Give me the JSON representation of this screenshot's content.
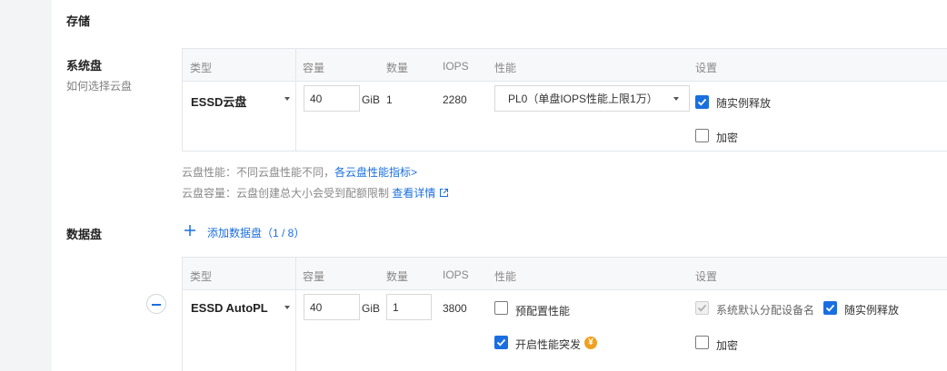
{
  "storage": {
    "title": "存储"
  },
  "system_disk": {
    "title": "系统盘",
    "help_link": "如何选择云盘",
    "headers": {
      "type": "类型",
      "capacity": "容量",
      "count": "数量",
      "iops": "IOPS",
      "performance": "性能",
      "settings": "设置"
    },
    "type_value": "ESSD云盘",
    "capacity_value": "40",
    "unit": "GiB",
    "count_value": "1",
    "iops_value": "2280",
    "performance_value": "PL0（单盘IOPS性能上限1万）",
    "release_label": "随实例释放",
    "release_checked": true,
    "encrypt_label": "加密",
    "encrypt_checked": false
  },
  "notes": {
    "perf_prefix": "云盘性能：不同云盘性能不同，",
    "perf_link": "各云盘性能指标>",
    "cap_prefix": "云盘容量：云盘创建总大小会受到配额限制 ",
    "cap_link": "查看详情"
  },
  "data_disk": {
    "title": "数据盘",
    "add_label": "添加数据盘（1 / 8）",
    "headers": {
      "type": "类型",
      "capacity": "容量",
      "count": "数量",
      "iops": "IOPS",
      "performance": "性能",
      "settings": "设置"
    },
    "type_value": "ESSD AutoPL",
    "capacity_value": "40",
    "unit": "GiB",
    "count_value": "1",
    "iops_value": "3800",
    "preconfig_label": "预配置性能",
    "preconfig_checked": false,
    "burst_label": "开启性能突发",
    "burst_checked": true,
    "yen_symbol": "¥",
    "device_name_label": "系统默认分配设备名",
    "release_label": "随实例释放",
    "release_checked": true,
    "encrypt_label": "加密",
    "encrypt_checked": false
  },
  "colors": {
    "accent": "#1a6fe0",
    "burst_badge": "#f0a020"
  }
}
